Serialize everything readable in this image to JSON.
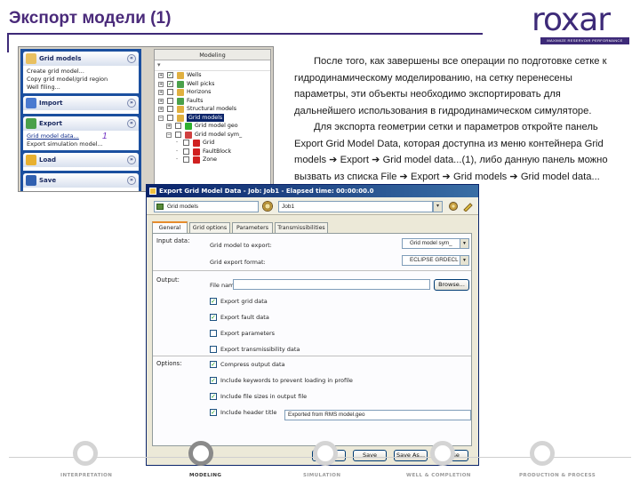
{
  "slide": {
    "title": "Экспорт модели (1)",
    "logo": {
      "name": "roxar",
      "tagline": "MAXIMIZE RESERVOIR PERFORMANCE"
    },
    "paragraphs": [
      "После того, как завершены все операции по подготовке сетке к гидродинамическому моделированию, на сетку перенесены параметры, эти объекты необходимо экспортировать для дальнейшего использования в гидродинамическом симуляторе.",
      "Для экспорта геометрии сетки и параметров откройте панель Export Grid Model Data, которая доступна из меню контейнера Grid models ➔ Export ➔ Grid model data...(1), либо данную панель можно вызвать из списка File ➔ Export ➔ Grid models ➔ Grid model data..."
    ]
  },
  "left_panel": {
    "nav": [
      {
        "title": "Grid models",
        "icon_color": "#e8c060",
        "chevron": "«",
        "links": [
          "Create grid model...",
          "Copy grid model/grid region",
          "Well filing..."
        ],
        "underlined": []
      },
      {
        "title": "Import",
        "icon_color": "#4a7ad0",
        "chevron": "»",
        "links": [],
        "underlined": []
      },
      {
        "title": "Export",
        "icon_color": "#4aa04a",
        "chevron": "«",
        "links": [
          "Grid model data...",
          "Export simulation model..."
        ],
        "underlined": [
          0
        ]
      },
      {
        "title": "Load",
        "icon_color": "#e8b030",
        "chevron": "»",
        "links": [],
        "underlined": []
      },
      {
        "title": "Save",
        "icon_color": "#3060b0",
        "chevron": "»",
        "links": [],
        "underlined": []
      }
    ],
    "callout_number": "1",
    "tree": {
      "title": "Modeling",
      "filter_icon": "funnel-icon",
      "rows": [
        {
          "label": "Wells",
          "pm": "+",
          "checked": true,
          "icon_color": "#e0b040",
          "selected": false,
          "indent": 0
        },
        {
          "label": "Well picks",
          "pm": "+",
          "checked": true,
          "icon_color": "#4aa04a",
          "selected": false,
          "indent": 0
        },
        {
          "label": "Horizons",
          "pm": "+",
          "checked": false,
          "icon_color": "#e0b040",
          "selected": false,
          "indent": 0
        },
        {
          "label": "Faults",
          "pm": "+",
          "checked": false,
          "icon_color": "#4aa04a",
          "selected": false,
          "indent": 0
        },
        {
          "label": "Structural models",
          "pm": "+",
          "checked": false,
          "icon_color": "#e0b040",
          "selected": false,
          "indent": 0
        },
        {
          "label": "Grid models",
          "pm": "−",
          "checked": false,
          "icon_color": "#e0b040",
          "selected": true,
          "indent": 0
        },
        {
          "label": "Grid model geo",
          "pm": "+",
          "checked": false,
          "icon_color": "#30b030",
          "selected": false,
          "indent": 1
        },
        {
          "label": "Grid model sym_",
          "pm": "−",
          "checked": false,
          "icon_color": "#d04040",
          "selected": false,
          "indent": 1
        },
        {
          "label": "Grid",
          "pm": "",
          "checked": false,
          "icon_color": "#d02020",
          "selected": false,
          "indent": 2
        },
        {
          "label": "FaultBlock",
          "pm": "",
          "checked": false,
          "icon_color": "#d02020",
          "selected": false,
          "indent": 2
        },
        {
          "label": "Zone",
          "pm": "",
          "checked": false,
          "icon_color": "#d02020",
          "selected": false,
          "indent": 2
        }
      ]
    }
  },
  "dialog": {
    "title": "Export Grid Model Data - Job: Job1 - Elapsed time: 00:00:00.0",
    "select_value": "Grid models",
    "job_value": "Job1",
    "tabs": [
      "General",
      "Grid options",
      "Parameters",
      "Transmissibilities"
    ],
    "active_tab": 0,
    "input_label": "Input data:",
    "output_label": "Output:",
    "options_label": "Options:",
    "grid_model_label": "Grid model to export:",
    "grid_model_value": "Grid model sym_",
    "format_label": "Grid export format:",
    "format_value": "ECLIPSE GRDECL",
    "filename_label": "File name:",
    "filename_value": "",
    "browse_label": "Browse...",
    "output_checks": [
      {
        "label": "Export grid data",
        "checked": true
      },
      {
        "label": "Export fault data",
        "checked": true
      },
      {
        "label": "Export parameters",
        "checked": false
      },
      {
        "label": "Export transmissibility data",
        "checked": false
      }
    ],
    "option_checks": [
      {
        "label": "Compress output data",
        "checked": true
      },
      {
        "label": "Include keywords to prevent loading in profile",
        "checked": true
      },
      {
        "label": "Include file sizes in output file",
        "checked": true
      },
      {
        "label": "Include header title",
        "checked": true
      }
    ],
    "header_value": "Exported from RMS model.geo",
    "buttons": [
      "Run",
      "Save",
      "Save As...",
      "Close"
    ]
  },
  "footer": {
    "stages": [
      "INTERPRETATION",
      "MODELING",
      "SIMULATION",
      "WELL & COMPLETION",
      "PRODUCTION & PROCESS"
    ],
    "active_stage": 1
  }
}
